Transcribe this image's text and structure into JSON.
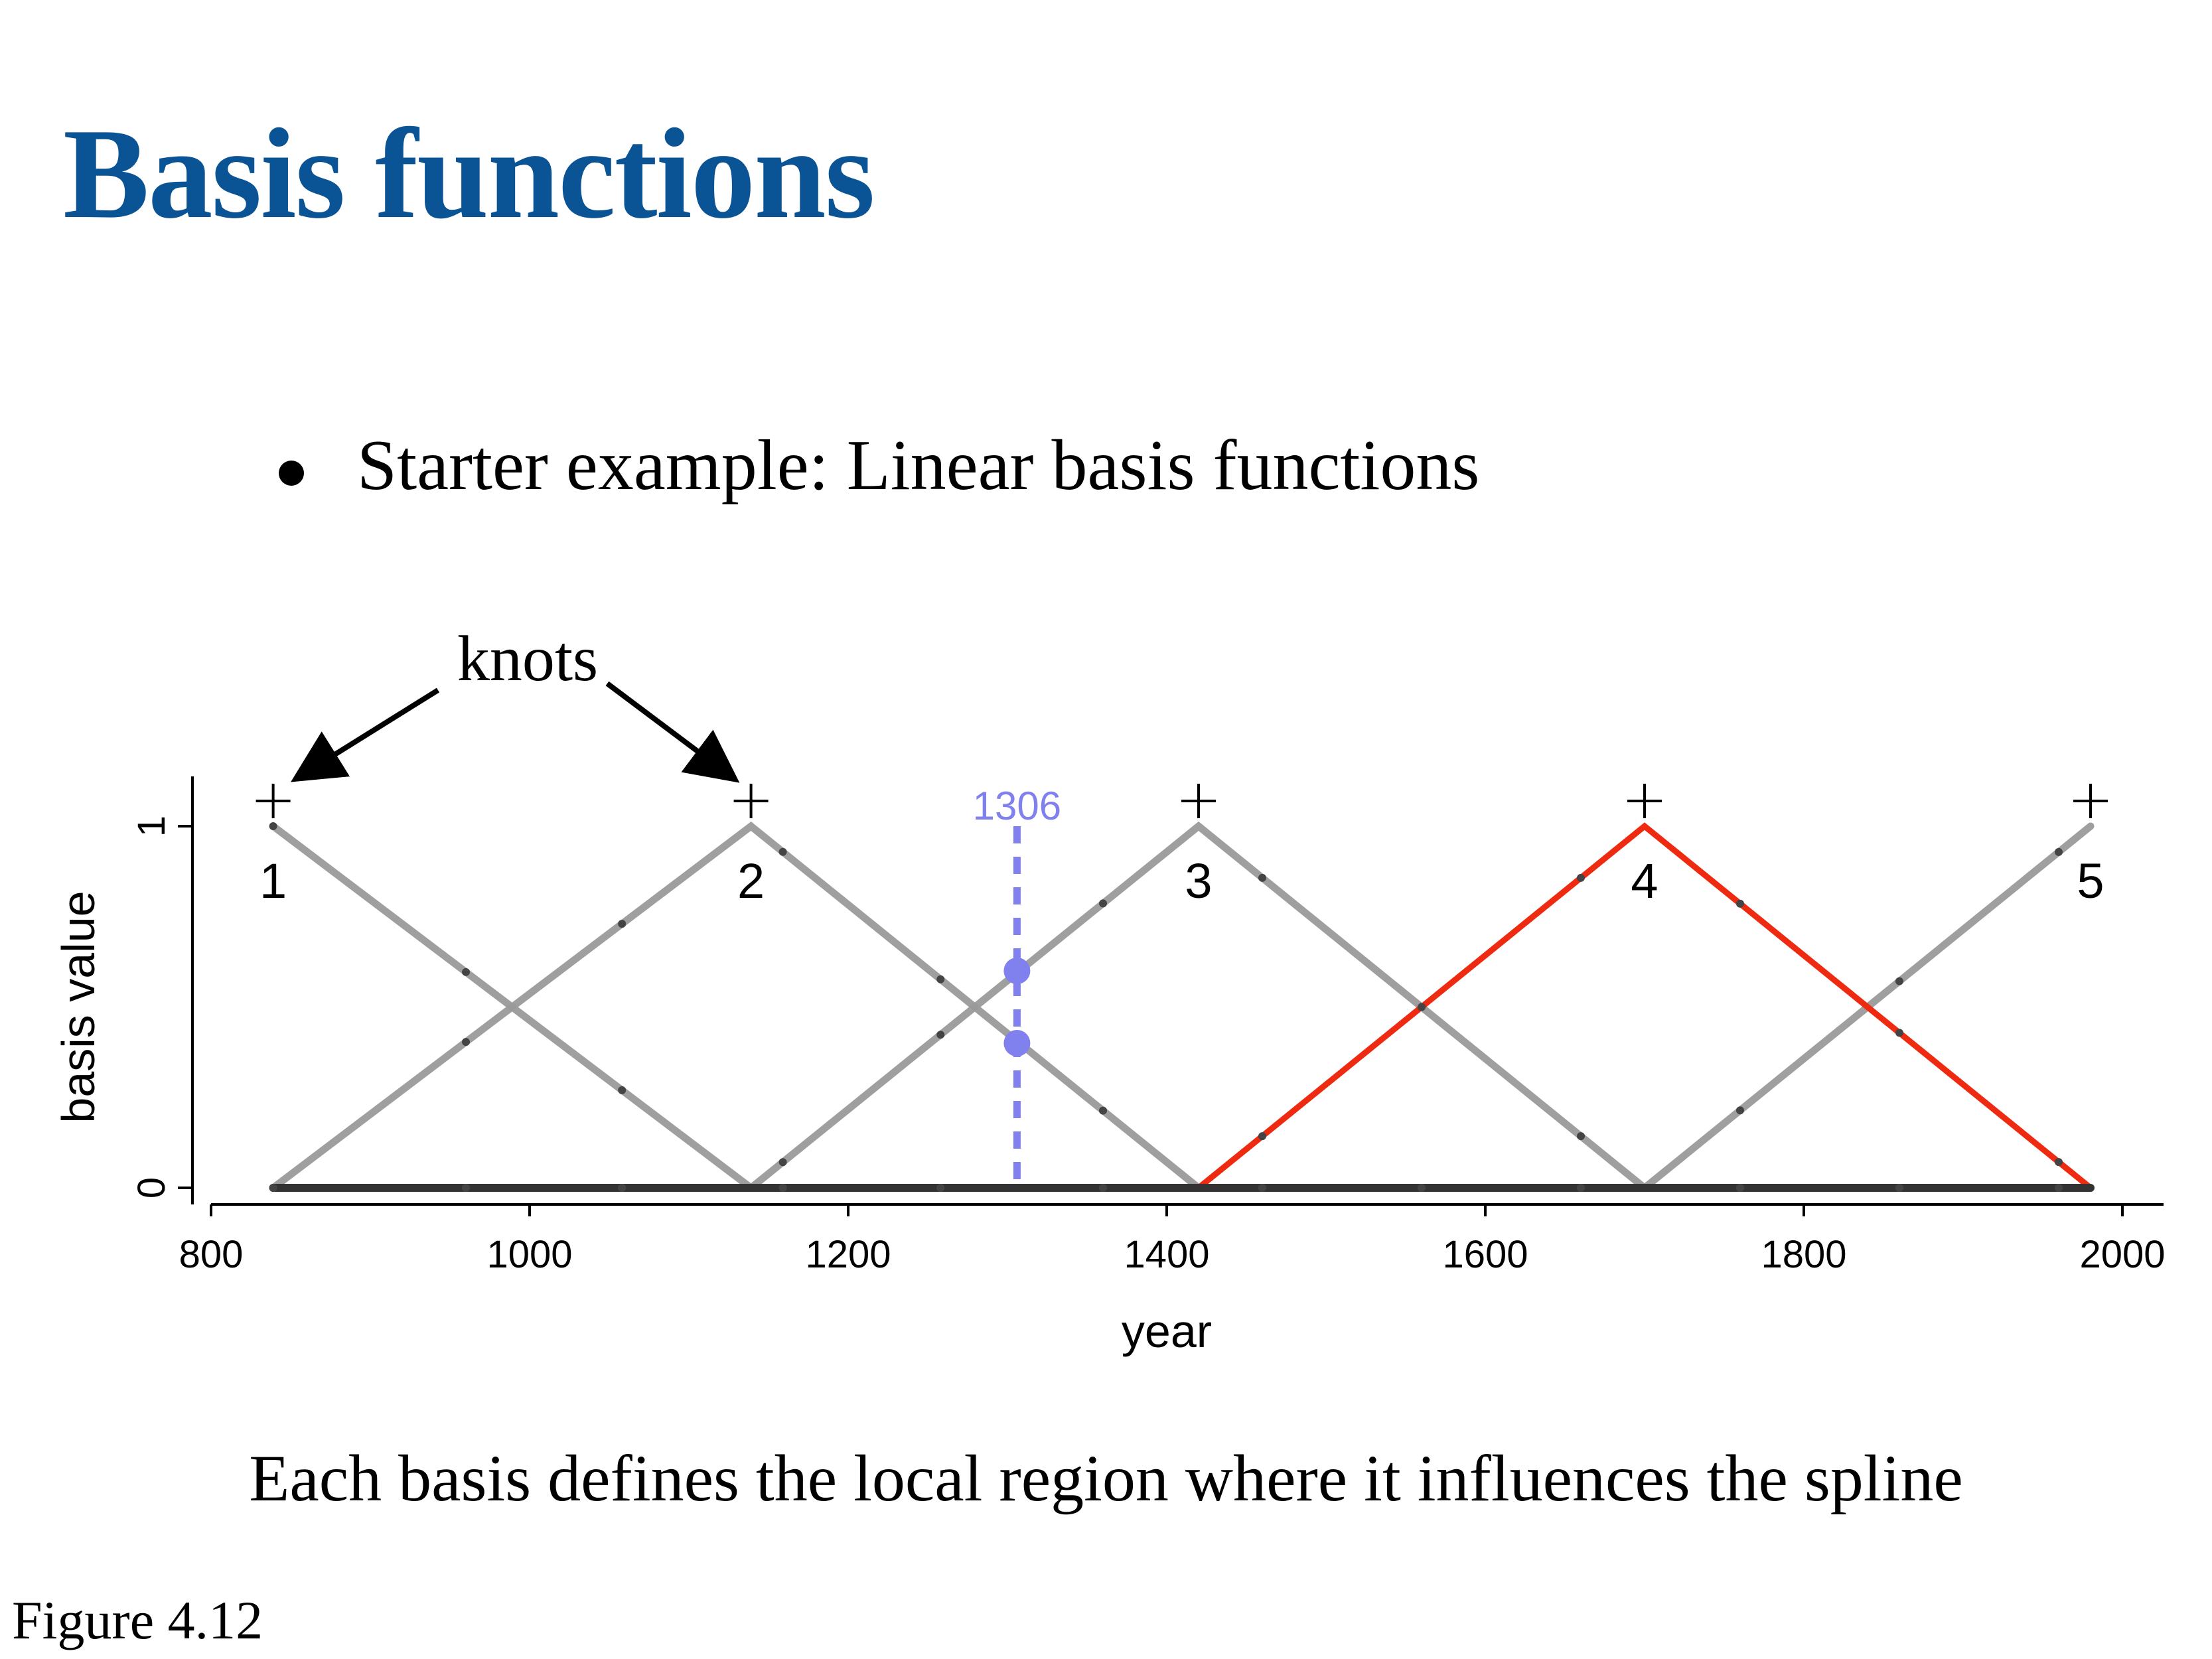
{
  "slide": {
    "title": "Basis functions",
    "bullet": "Starter example: Linear basis functions",
    "caption": "Each basis defines the local region where it influences the spline",
    "figure_label": "Figure 4.12"
  },
  "colors": {
    "title": "#0a5394",
    "basis": "#9a9a9a",
    "highlight": "#ee2a10",
    "marker": "#8080ee",
    "baseline": "#333333"
  },
  "chart_data": {
    "type": "line",
    "xlabel": "year",
    "ylabel": "basis value",
    "xlim": [
      800,
      2000
    ],
    "ylim": [
      0,
      1
    ],
    "x_ticks": [
      800,
      1000,
      1200,
      1400,
      1600,
      1800,
      2000
    ],
    "y_ticks": [
      0,
      1
    ],
    "knots": [
      {
        "label": "1",
        "x": 839
      },
      {
        "label": "2",
        "x": 1139
      },
      {
        "label": "3",
        "x": 1420
      },
      {
        "label": "4",
        "x": 1700
      },
      {
        "label": "5",
        "x": 1980
      }
    ],
    "series": [
      {
        "x": [
          839,
          1139,
          1980
        ],
        "y": [
          1,
          0,
          0
        ],
        "highlight": false
      },
      {
        "x": [
          839,
          1139,
          1420,
          1980
        ],
        "y": [
          0,
          1,
          0,
          0
        ],
        "highlight": false
      },
      {
        "x": [
          839,
          1139,
          1420,
          1700,
          1980
        ],
        "y": [
          0,
          0,
          1,
          0,
          0
        ],
        "highlight": false
      },
      {
        "x": [
          839,
          1420,
          1700,
          1980
        ],
        "y": [
          0,
          0,
          1,
          0
        ],
        "highlight": true
      },
      {
        "x": [
          839,
          1700,
          1980
        ],
        "y": [
          0,
          0,
          1
        ],
        "highlight": false
      }
    ],
    "data_points_x": [
      839,
      960,
      1058,
      1159,
      1258,
      1306,
      1360,
      1460,
      1560,
      1660,
      1760,
      1860,
      1960
    ],
    "marker": {
      "label": "1306",
      "x": 1306,
      "points": [
        0.6,
        0.4
      ]
    },
    "annotation": {
      "text": "knots",
      "arrow_targets": [
        "1",
        "2"
      ]
    }
  }
}
